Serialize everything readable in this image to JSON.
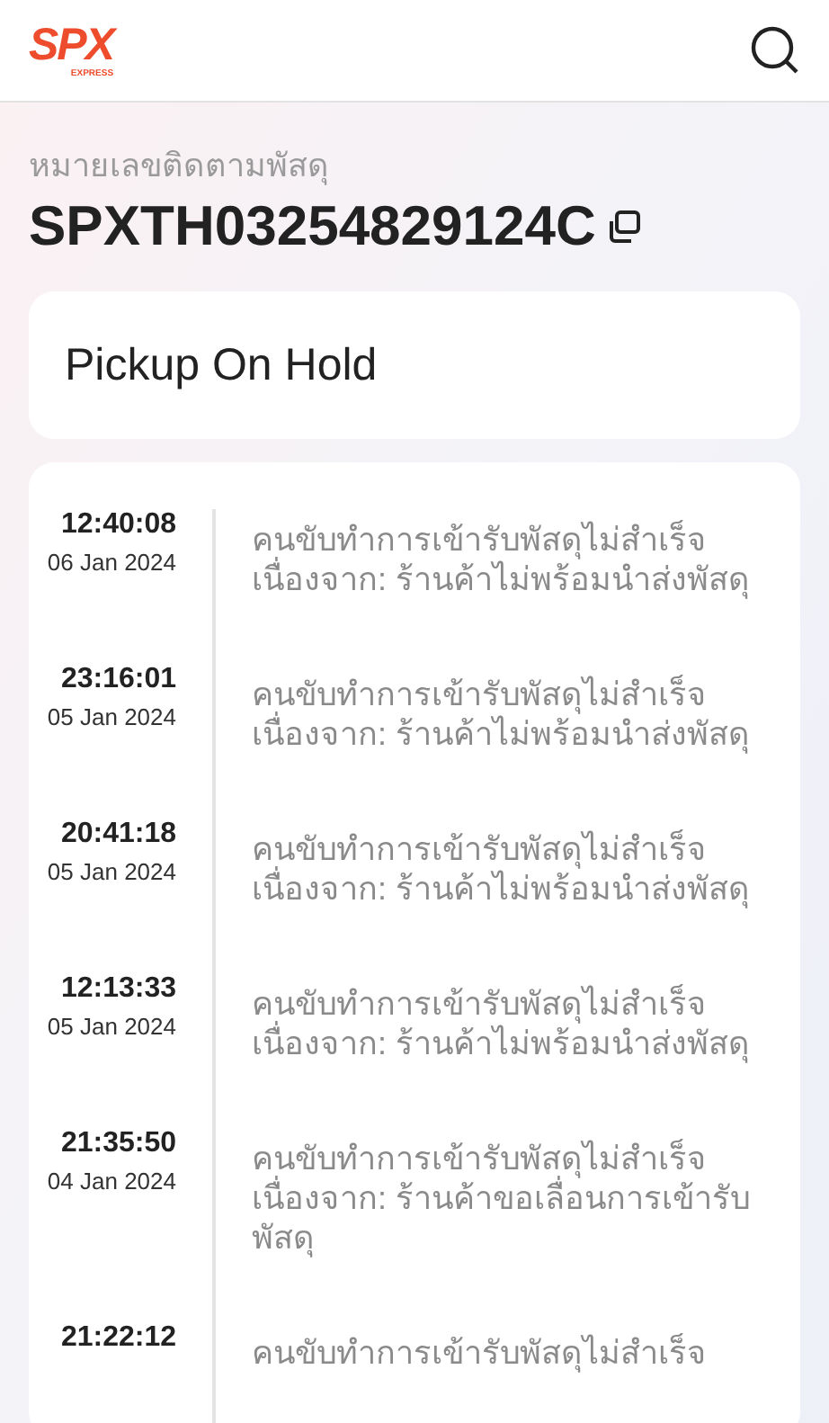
{
  "header": {
    "logo": {
      "mark": "SPX",
      "subtitle": "EXPRESS"
    }
  },
  "tracking": {
    "label": "หมายเลขติดตามพัสดุ",
    "number": "SPXTH03254829124C"
  },
  "status": {
    "title": "Pickup On Hold"
  },
  "timeline": [
    {
      "time": "12:40:08",
      "date": "06 Jan 2024",
      "lines": [
        "คนขับทำการเข้ารับพัสดุไม่สำเร็จ",
        "เนื่องจาก: ร้านค้าไม่พร้อมนำส่งพัสดุ"
      ]
    },
    {
      "time": "23:16:01",
      "date": "05 Jan 2024",
      "lines": [
        "คนขับทำการเข้ารับพัสดุไม่สำเร็จ",
        "เนื่องจาก: ร้านค้าไม่พร้อมนำส่งพัสดุ"
      ]
    },
    {
      "time": "20:41:18",
      "date": "05 Jan 2024",
      "lines": [
        "คนขับทำการเข้ารับพัสดุไม่สำเร็จ",
        "เนื่องจาก: ร้านค้าไม่พร้อมนำส่งพัสดุ"
      ]
    },
    {
      "time": "12:13:33",
      "date": "05 Jan 2024",
      "lines": [
        "คนขับทำการเข้ารับพัสดุไม่สำเร็จ",
        "เนื่องจาก: ร้านค้าไม่พร้อมนำส่งพัสดุ"
      ]
    },
    {
      "time": "21:35:50",
      "date": "04 Jan 2024",
      "lines": [
        "คนขับทำการเข้ารับพัสดุไม่สำเร็จ",
        "เนื่องจาก: ร้านค้าขอเลื่อนการเข้ารับ",
        "พัสดุ"
      ]
    },
    {
      "time": "21:22:12",
      "lines": [
        "คนขับทำการเข้ารับพัสดุไม่สำเร็จ"
      ]
    }
  ]
}
